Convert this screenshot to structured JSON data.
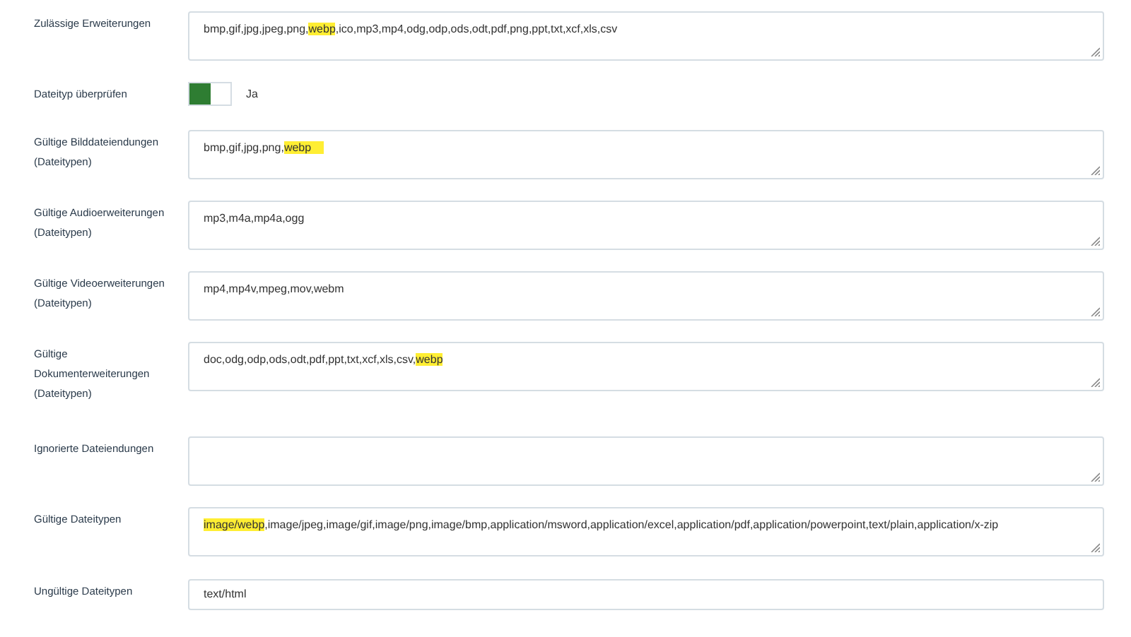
{
  "fields": [
    {
      "kind": "textarea",
      "label": [
        "Zulässige Erweiterungen"
      ],
      "value": [
        {
          "text": "bmp,gif,jpg,jpeg,png,",
          "highlight": false
        },
        {
          "text": "webp",
          "highlight": true
        },
        {
          "text": ",ico,mp3,mp4,odg,odp,ods,odt,pdf,png,ppt,txt,xcf,xls,csv",
          "highlight": false
        }
      ]
    },
    {
      "kind": "toggle",
      "label": [
        "Dateityp überprüfen"
      ],
      "on": true,
      "text": "Ja"
    },
    {
      "kind": "textarea",
      "label": [
        "Gültige Bilddateiendungen",
        "(Dateitypen)"
      ],
      "value": [
        {
          "text": "bmp,gif,jpg,png,",
          "highlight": false
        },
        {
          "text": "webp    ",
          "highlight": true
        }
      ]
    },
    {
      "kind": "textarea",
      "label": [
        "Gültige Audioerweiterungen",
        "(Dateitypen)"
      ],
      "value": [
        {
          "text": "mp3,m4a,mp4a,ogg",
          "highlight": false
        }
      ]
    },
    {
      "kind": "textarea",
      "label": [
        "Gültige Videoerweiterungen",
        "(Dateitypen)"
      ],
      "value": [
        {
          "text": "mp4,mp4v,mpeg,mov,webm",
          "highlight": false
        }
      ]
    },
    {
      "kind": "textarea",
      "label": [
        "Gültige",
        "Dokumenterweiterungen",
        "(Dateitypen)"
      ],
      "value": [
        {
          "text": "doc,odg,odp,ods,odt,pdf,ppt,txt,xcf,xls,csv,",
          "highlight": false
        },
        {
          "text": "webp",
          "highlight": true
        }
      ]
    },
    {
      "kind": "textarea",
      "label": [
        "Ignorierte Dateiendungen"
      ]
    },
    {
      "kind": "textarea",
      "label": [
        "Gültige Dateitypen"
      ],
      "value": [
        {
          "text": "image/webp",
          "highlight": true
        },
        {
          "text": ",image/jpeg,image/gif,image/png,image/bmp,application/msword,application/excel,application/pdf,application/powerpoint,text/plain,application/x-zip",
          "highlight": false
        }
      ]
    },
    {
      "kind": "input",
      "label": [
        "Ungültige Dateitypen"
      ],
      "value": [
        {
          "text": "text/html",
          "highlight": false
        }
      ]
    }
  ]
}
